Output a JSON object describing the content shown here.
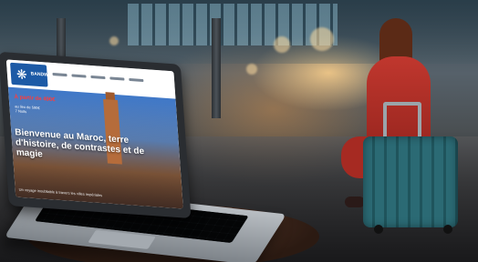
{
  "screen": {
    "logo_text": "BANDWAGON",
    "logo_mark": "❋",
    "promo_title": "À partir de 490€",
    "promo_sub_line1": "au lieu de 590€",
    "promo_sub_line2": "7 Nuits",
    "headline": "Bienvenue au Maroc, terre d'histoire, de contrastes et de magie",
    "caption": "Un voyage inoubliable à travers les villes impériales"
  },
  "colors": {
    "brand": "#1c5aa6",
    "promo": "#ff3b3b",
    "coat": "#c0372e",
    "suitcase": "#2b6a74"
  }
}
